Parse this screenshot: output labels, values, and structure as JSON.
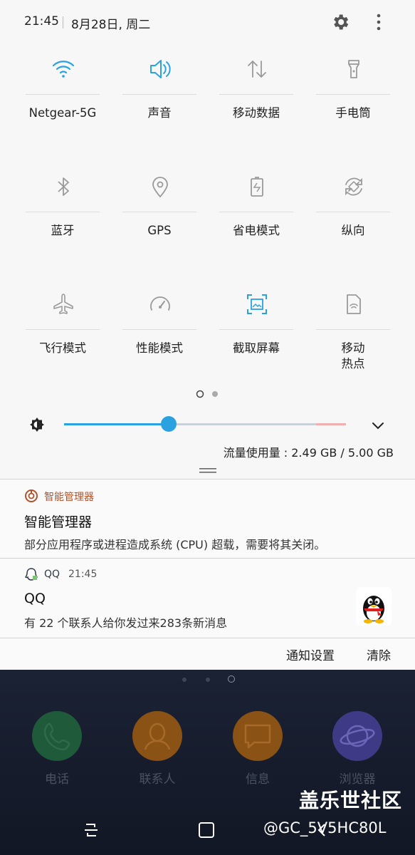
{
  "status": {
    "time": "21:45",
    "date": "8月28日, 周二"
  },
  "tiles": [
    {
      "label": "Netgear-5G",
      "icon": "wifi-icon",
      "active": true
    },
    {
      "label": "声音",
      "icon": "sound-icon",
      "active": true
    },
    {
      "label": "移动数据",
      "icon": "mobile-data-icon",
      "active": false
    },
    {
      "label": "手电筒",
      "icon": "flashlight-icon",
      "active": false
    },
    {
      "label": "蓝牙",
      "icon": "bluetooth-icon",
      "active": false
    },
    {
      "label": "GPS",
      "icon": "gps-icon",
      "active": false
    },
    {
      "label": "省电模式",
      "icon": "power-saving-icon",
      "active": false
    },
    {
      "label": "纵向",
      "icon": "rotation-icon",
      "active": false
    },
    {
      "label": "飞行模式",
      "icon": "airplane-icon",
      "active": false
    },
    {
      "label": "性能模式",
      "icon": "performance-icon",
      "active": false
    },
    {
      "label": "截取屏幕",
      "icon": "screenshot-icon",
      "active": true
    },
    {
      "label": "移动\n热点",
      "icon": "hotspot-icon",
      "active": false
    }
  ],
  "brightness": {
    "level": 0.37
  },
  "data_usage": "流量使用量 : 2.49 GB / 5.00 GB",
  "notifications": [
    {
      "app": "智能管理器",
      "time": "",
      "title": "智能管理器",
      "text": "部分应用程序或进程造成系统 (CPU) 超载，需要将其关闭。",
      "app_color": "#b0522a"
    },
    {
      "app": "QQ",
      "time": "21:45",
      "title": "QQ",
      "text": "有 22 个联系人给你发过来283条新消息",
      "app_color": "#2f3a44"
    }
  ],
  "actions": {
    "settings": "通知设置",
    "clear": "清除"
  },
  "home_apps": [
    {
      "label": "电话",
      "color": "#1f5a3a"
    },
    {
      "label": "联系人",
      "color": "#8a5214"
    },
    {
      "label": "信息",
      "color": "#8a5214"
    },
    {
      "label": "浏览器",
      "color": "#3f3a86"
    }
  ],
  "watermark": {
    "line1": "盖乐世社区",
    "line2": "@GC_5V5HC80L"
  },
  "colors": {
    "accent": "#2aa2e0",
    "icon_inactive": "#9a9a9a"
  }
}
